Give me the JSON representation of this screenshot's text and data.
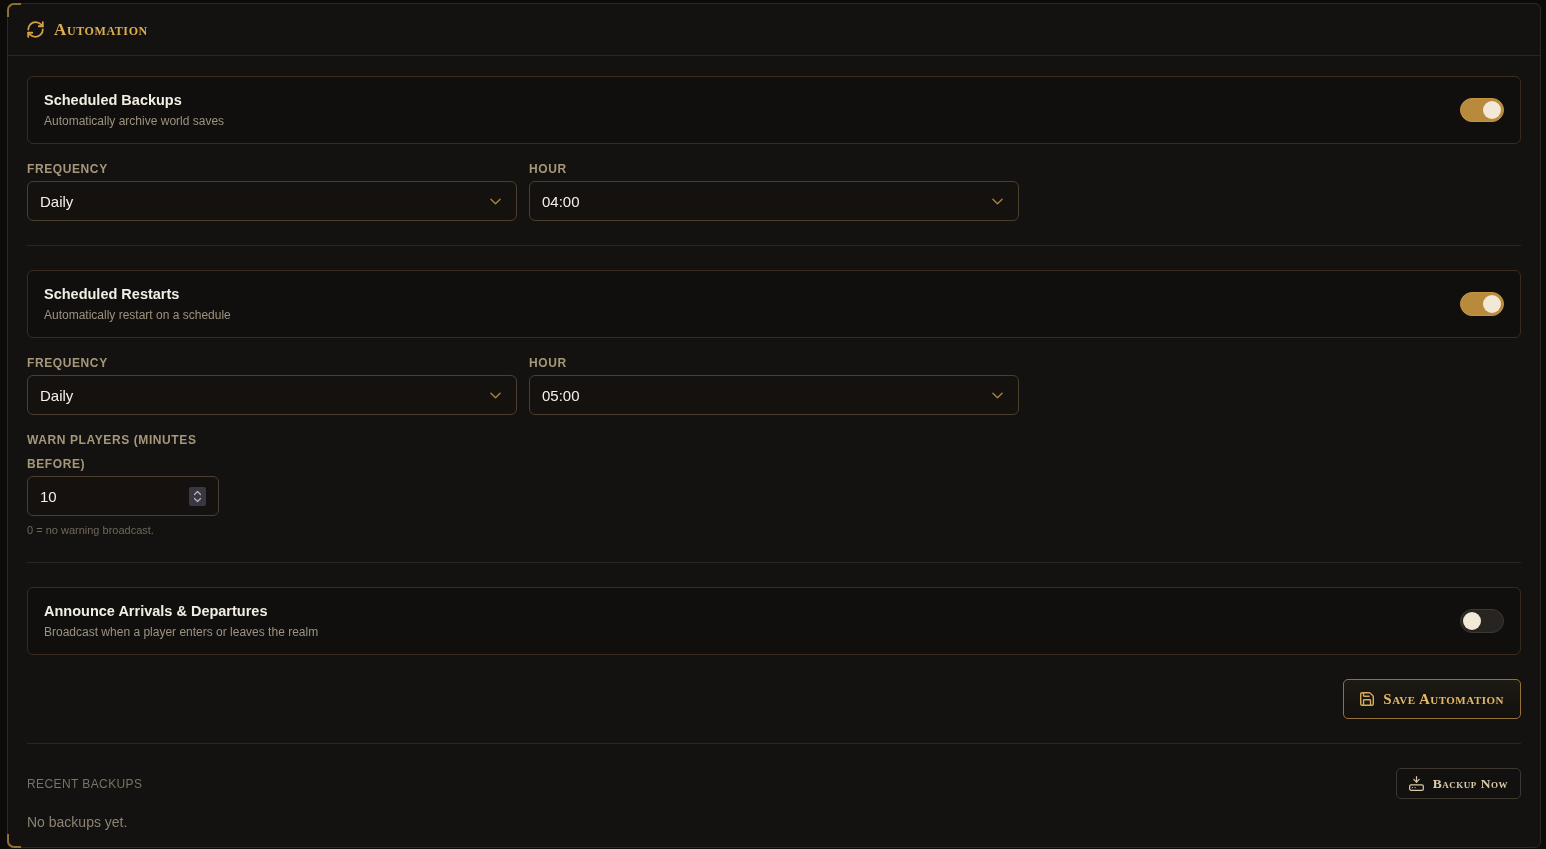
{
  "panel": {
    "title": "Automation"
  },
  "groups": [
    {
      "toggle": {
        "title": "Scheduled Backups",
        "description": "Automatically archive world saves",
        "on": true
      },
      "fields": [
        {
          "kind": "select",
          "label": "FREQUENCY",
          "value": "Daily"
        },
        {
          "kind": "select",
          "label": "HOUR",
          "value": "04:00"
        }
      ]
    },
    {
      "toggle": {
        "title": "Scheduled Restarts",
        "description": "Automatically restart on a schedule",
        "on": true
      },
      "fields": [
        {
          "kind": "select",
          "label": "FREQUENCY",
          "value": "Daily"
        },
        {
          "kind": "select",
          "label": "HOUR",
          "value": "05:00"
        },
        {
          "kind": "number",
          "label": "WARN PLAYERS (MINUTES BEFORE)",
          "value": "10",
          "hint": "0 = no warning broadcast."
        }
      ]
    },
    {
      "toggle": {
        "title": "Announce Arrivals & Departures",
        "description": "Broadcast when a player enters or leaves the realm",
        "on": false
      }
    }
  ],
  "save_button": {
    "label": "Save Automation"
  },
  "recent_backups": {
    "heading": "RECENT BACKUPS",
    "button": {
      "label": "Backup Now"
    },
    "empty_text": "No backups yet."
  }
}
